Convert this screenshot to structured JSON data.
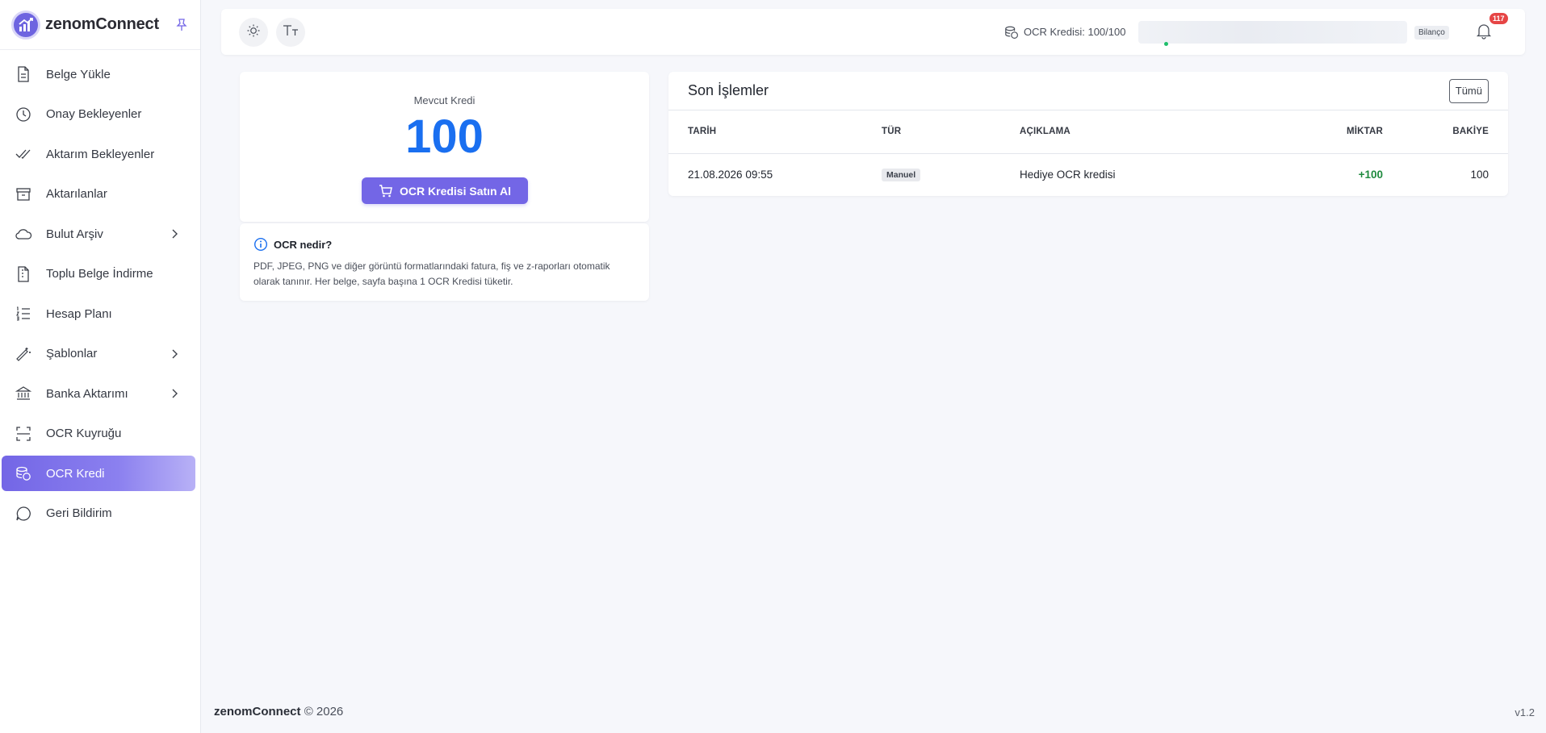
{
  "brand": {
    "name": "zenomConnect"
  },
  "sidebar": {
    "items": [
      {
        "label": "Belge Yükle",
        "icon": "file-icon",
        "chevron": false,
        "active": false
      },
      {
        "label": "Onay Bekleyenler",
        "icon": "clock-icon",
        "chevron": false,
        "active": false
      },
      {
        "label": "Aktarım Bekleyenler",
        "icon": "double-check-icon",
        "chevron": false,
        "active": false
      },
      {
        "label": "Aktarılanlar",
        "icon": "archive-icon",
        "chevron": false,
        "active": false
      },
      {
        "label": "Bulut Arşiv",
        "icon": "cloud-icon",
        "chevron": true,
        "active": false
      },
      {
        "label": "Toplu Belge İndirme",
        "icon": "file-zip-icon",
        "chevron": false,
        "active": false
      },
      {
        "label": "Hesap Planı",
        "icon": "list-ordered-icon",
        "chevron": false,
        "active": false
      },
      {
        "label": "Şablonlar",
        "icon": "magic-wand-icon",
        "chevron": true,
        "active": false
      },
      {
        "label": "Banka Aktarımı",
        "icon": "bank-icon",
        "chevron": true,
        "active": false
      },
      {
        "label": "OCR Kuyruğu",
        "icon": "scan-icon",
        "chevron": false,
        "active": false
      },
      {
        "label": "OCR Kredi",
        "icon": "coins-icon",
        "chevron": false,
        "active": true
      },
      {
        "label": "Geri Bildirim",
        "icon": "message-icon",
        "chevron": false,
        "active": false
      }
    ]
  },
  "topbar": {
    "credit_text": "OCR Kredisi: 100/100",
    "company_tag": "Bilanço",
    "notification_count": "117"
  },
  "credit": {
    "label": "Mevcut Kredi",
    "value": "100",
    "buy_label": "OCR Kredisi Satın Al"
  },
  "info": {
    "title": "OCR nedir?",
    "text": "PDF, JPEG, PNG ve diğer görüntü formatlarındaki fatura, fiş ve z-raporları otomatik olarak tanınır. Her belge, sayfa başına 1 OCR Kredisi tüketir."
  },
  "transactions": {
    "title": "Son İşlemler",
    "all_label": "Tümü",
    "columns": [
      "TARİH",
      "TÜR",
      "AÇIKLAMA",
      "MİKTAR",
      "BAKİYE"
    ],
    "rows": [
      {
        "date": "21.08.2026 09:55",
        "type": "Manuel",
        "description": "Hediye OCR kredisi",
        "amount": "+100",
        "balance": "100"
      }
    ]
  },
  "footer": {
    "brand": "zenomConnect",
    "copyright": "© 2026",
    "version": "v1.2"
  },
  "colors": {
    "accent": "#7366e6",
    "credit_value": "#1a6ff0",
    "positive": "#1f8a3e",
    "badge": "#e64545"
  }
}
